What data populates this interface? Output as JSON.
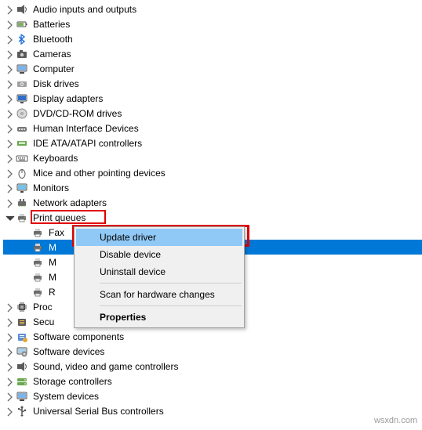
{
  "tree": {
    "items": [
      {
        "label": "Audio inputs and outputs",
        "icon": "audio"
      },
      {
        "label": "Batteries",
        "icon": "battery"
      },
      {
        "label": "Bluetooth",
        "icon": "bluetooth"
      },
      {
        "label": "Cameras",
        "icon": "camera"
      },
      {
        "label": "Computer",
        "icon": "computer"
      },
      {
        "label": "Disk drives",
        "icon": "disk"
      },
      {
        "label": "Display adapters",
        "icon": "display"
      },
      {
        "label": "DVD/CD-ROM drives",
        "icon": "dvd"
      },
      {
        "label": "Human Interface Devices",
        "icon": "hid"
      },
      {
        "label": "IDE ATA/ATAPI controllers",
        "icon": "ide"
      },
      {
        "label": "Keyboards",
        "icon": "keyboard"
      },
      {
        "label": "Mice and other pointing devices",
        "icon": "mouse"
      },
      {
        "label": "Monitors",
        "icon": "monitor"
      },
      {
        "label": "Network adapters",
        "icon": "network"
      }
    ],
    "expanded": {
      "label": "Print queues",
      "icon": "printer",
      "children": [
        {
          "label": "Fax",
          "icon": "printer"
        },
        {
          "label": "M",
          "icon": "printer",
          "selected": true
        },
        {
          "label": "M",
          "icon": "printer"
        },
        {
          "label": "M",
          "icon": "printer"
        },
        {
          "label": "R",
          "icon": "printer"
        }
      ]
    },
    "items2": [
      {
        "label": "Proc",
        "icon": "processor"
      },
      {
        "label": "Secu",
        "icon": "security"
      },
      {
        "label": "Software components",
        "icon": "swcomp"
      },
      {
        "label": "Software devices",
        "icon": "swdev"
      },
      {
        "label": "Sound, video and game controllers",
        "icon": "sound"
      },
      {
        "label": "Storage controllers",
        "icon": "storage"
      },
      {
        "label": "System devices",
        "icon": "system"
      },
      {
        "label": "Universal Serial Bus controllers",
        "icon": "usb"
      }
    ]
  },
  "context_menu": {
    "update": "Update driver",
    "disable": "Disable device",
    "uninstall": "Uninstall device",
    "scan": "Scan for hardware changes",
    "properties": "Properties"
  },
  "watermark": "wsxdn.com"
}
